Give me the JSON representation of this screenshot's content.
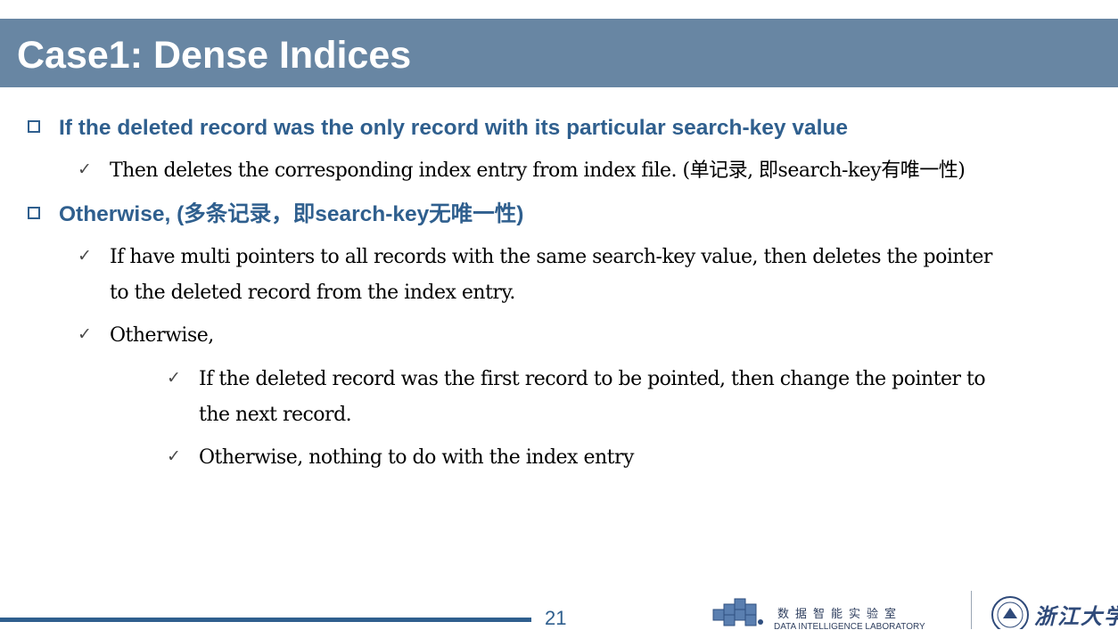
{
  "title": "Case1: Dense Indices",
  "items": [
    {
      "text": "If the deleted record was the only record with its particular search-key value",
      "subs": [
        {
          "line1": "Then deletes the corresponding index entry from index file.  (单记录, 即search-key有唯一性)"
        }
      ]
    },
    {
      "text": "Otherwise, (多条记录，即search-key无唯一性)",
      "subs": [
        {
          "line1": "If have multi pointers to all records with the same search-key value, then deletes the  pointer",
          "line2": "to the deleted record from the index entry."
        },
        {
          "line1": "Otherwise,",
          "subs": [
            {
              "line1": "If the deleted record was the first record to be pointed,  then change the pointer to",
              "line2": "the next record."
            },
            {
              "line1": "Otherwise, nothing to do with the index entry"
            }
          ]
        }
      ]
    }
  ],
  "footer": {
    "page_number": "21",
    "lab_name_cn": "数据智能实验室",
    "lab_name_en": "DATA INTELLIGENCE LABORATORY",
    "university_name_cn": "浙江大学"
  },
  "colors": {
    "title_bar": "#6886a3",
    "accent": "#2f5f8e",
    "body_text": "#000000"
  },
  "icons": [
    "hollow-square-bullet-icon",
    "checkmark-bullet-icon",
    "lab-cubes-logo-icon",
    "university-seal-icon"
  ]
}
